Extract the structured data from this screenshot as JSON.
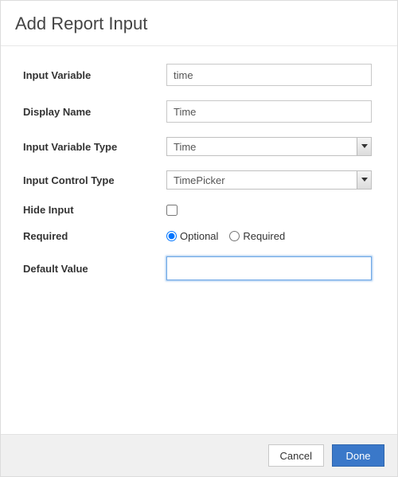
{
  "header": {
    "title": "Add Report Input"
  },
  "fields": {
    "input_variable": {
      "label": "Input Variable",
      "value": "time"
    },
    "display_name": {
      "label": "Display Name",
      "value": "Time"
    },
    "input_variable_type": {
      "label": "Input Variable Type",
      "value": "Time"
    },
    "input_control_type": {
      "label": "Input Control Type",
      "value": "TimePicker"
    },
    "hide_input": {
      "label": "Hide Input",
      "checked": false
    },
    "required": {
      "label": "Required",
      "options": {
        "optional": "Optional",
        "required": "Required"
      },
      "selected": "optional"
    },
    "default_value": {
      "label": "Default Value",
      "value": ""
    }
  },
  "footer": {
    "cancel": "Cancel",
    "done": "Done"
  }
}
